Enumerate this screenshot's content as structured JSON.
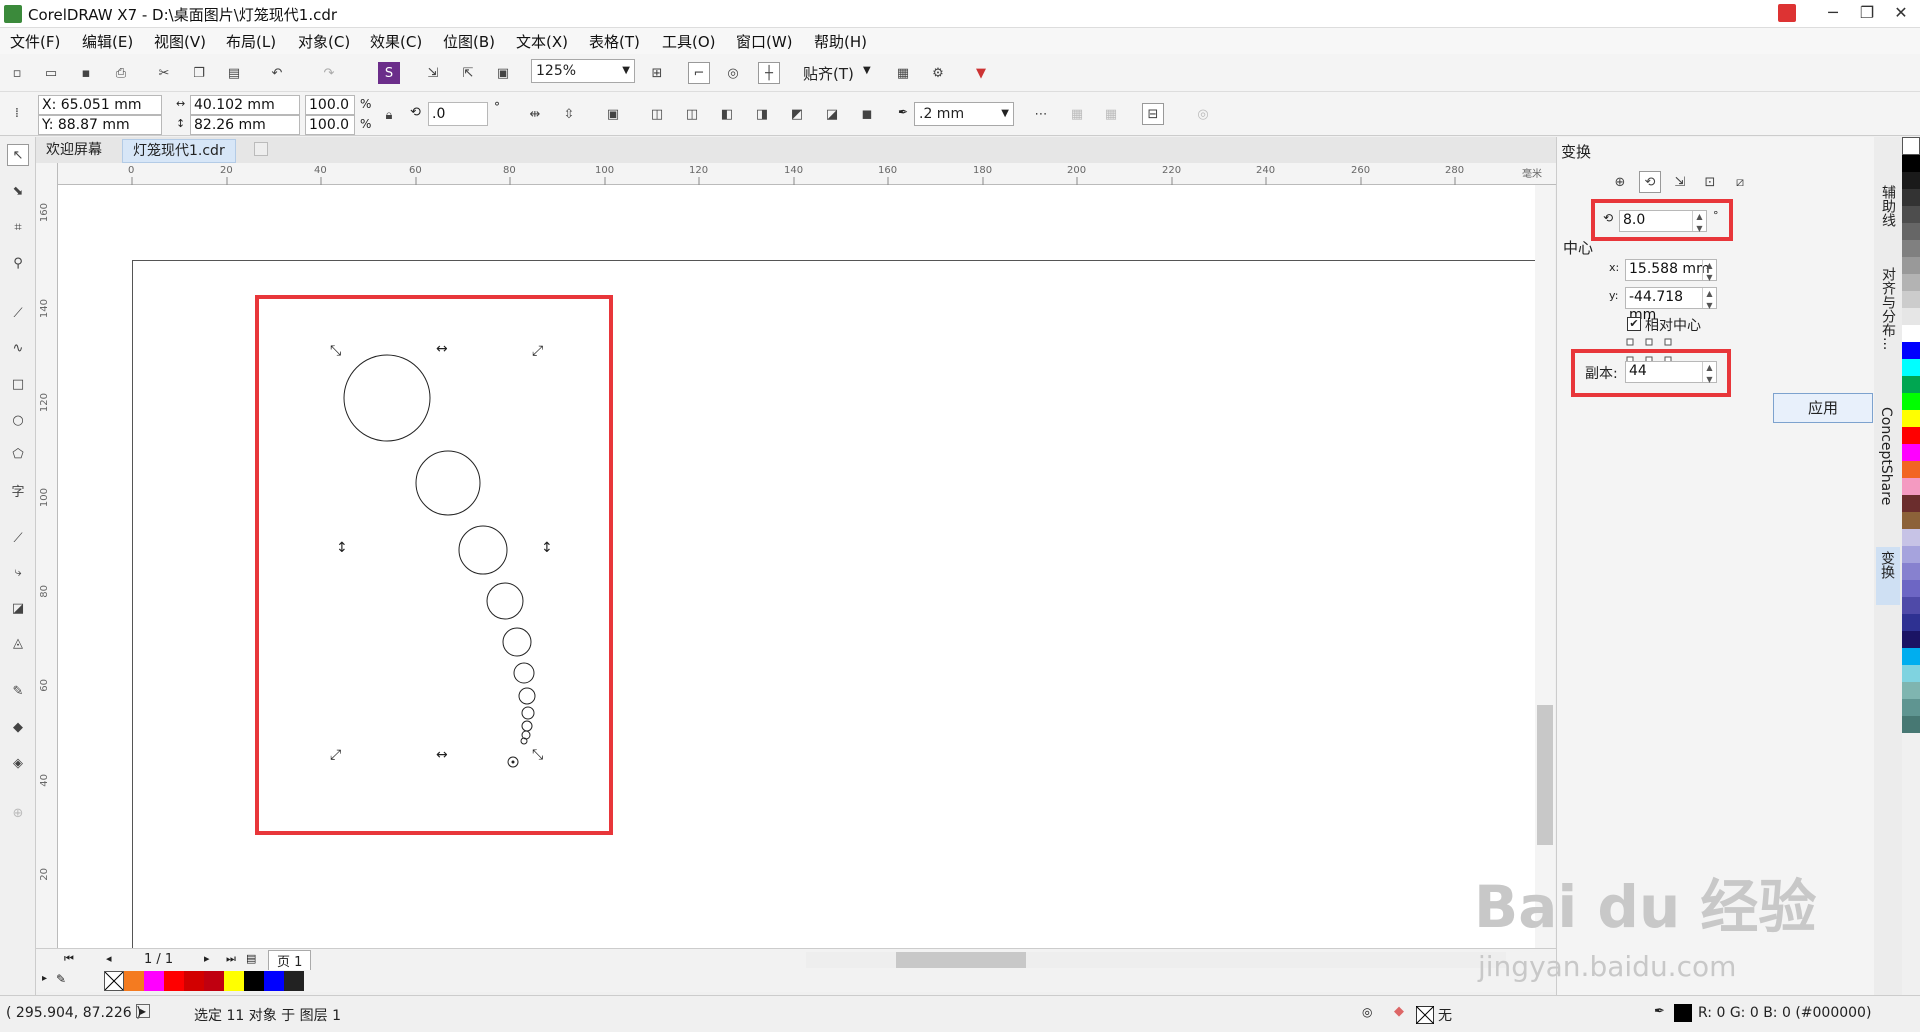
{
  "window": {
    "title": "CorelDRAW X7 - D:\\桌面图片\\灯笼现代1.cdr"
  },
  "menu": [
    "文件(F)",
    "编辑(E)",
    "视图(V)",
    "布局(L)",
    "对象(C)",
    "效果(C)",
    "位图(B)",
    "文本(X)",
    "表格(T)",
    "工具(O)",
    "窗口(W)",
    "帮助(H)"
  ],
  "toolbar": {
    "zoom": "125%",
    "snap_label": "贴齐(T)"
  },
  "propbar": {
    "x": "X: 65.051 mm",
    "y": "Y: 88.87 mm",
    "width": "40.102 mm",
    "height": "82.26 mm",
    "scale_w": "100.0",
    "scale_h": "100.0",
    "pct": "%",
    "angle": ".0",
    "deg": "°",
    "outline": ".2 mm"
  },
  "tabs": {
    "welcome": "欢迎屏幕",
    "doc": "灯笼现代1.cdr"
  },
  "ruler": {
    "h_ticks": [
      "0",
      "20",
      "40",
      "60",
      "80",
      "100",
      "120",
      "140",
      "160",
      "180",
      "200",
      "220",
      "240",
      "260",
      "280"
    ],
    "v_ticks": [
      "160",
      "140",
      "120",
      "100",
      "80",
      "60",
      "40",
      "20"
    ],
    "unit": "毫米"
  },
  "pager": {
    "page_count": "1 / 1",
    "page_tab": "页 1"
  },
  "docker": {
    "title": "变换",
    "rotation_value": "8.0",
    "deg": "°",
    "center_label": "中心",
    "x_label": "x:",
    "x_value": "15.588 mm",
    "y_label": "y:",
    "y_value": "-44.718 mm",
    "relative_label": "相对中心",
    "copies_label": "副本:",
    "copies_value": "44",
    "apply": "应用"
  },
  "vtabs": [
    "辅助线",
    "对齐与分布...",
    "ConceptShare",
    "变换"
  ],
  "status": {
    "coords": "( 295.904, 87.226 )",
    "selection": "选定 11 对象 于 图层 1",
    "fill_none": "无",
    "color_info": "R: 0 G: 0 B: 0 (#000000)"
  },
  "watermark": {
    "brand": "Bai du 经验",
    "url": "jingyan.baidu.com"
  },
  "colors": {
    "highlight": "#e8363a",
    "accent": "#3b8a3b"
  }
}
